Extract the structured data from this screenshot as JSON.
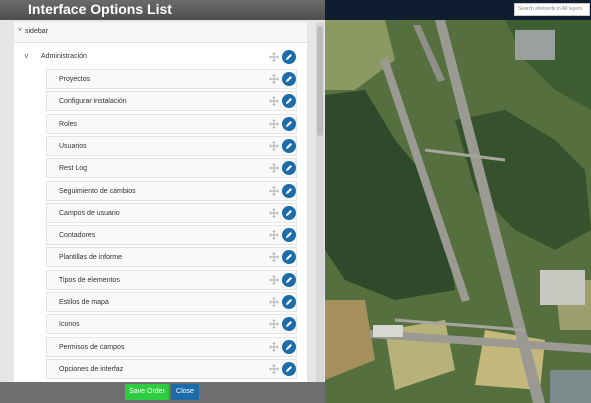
{
  "dialog": {
    "title": "Interface Options List",
    "group_label": "sidebar",
    "section_label": "Administración",
    "items": [
      {
        "label": "Proyectos"
      },
      {
        "label": "Configurar instalación"
      },
      {
        "label": "Roles"
      },
      {
        "label": "Usuarios"
      },
      {
        "label": "Rest Log"
      },
      {
        "label": "Seguimiento de cambios"
      },
      {
        "label": "Campos de usuario"
      },
      {
        "label": "Contadores"
      },
      {
        "label": "Plantillas de informe"
      },
      {
        "label": "Tipos de elementos"
      },
      {
        "label": "Estilos de mapa"
      },
      {
        "label": "Iconos"
      },
      {
        "label": "Permisos de campos"
      },
      {
        "label": "Opciones de interfaz"
      }
    ],
    "save_label": "Save Order",
    "close_label": "Close"
  },
  "map": {
    "search_placeholder": "Search elements in All layers"
  },
  "colors": {
    "accent": "#1b6ca8",
    "save": "#2ecc40",
    "titlebar": "#5a5a5a",
    "map_topbar": "#0e1e30"
  }
}
